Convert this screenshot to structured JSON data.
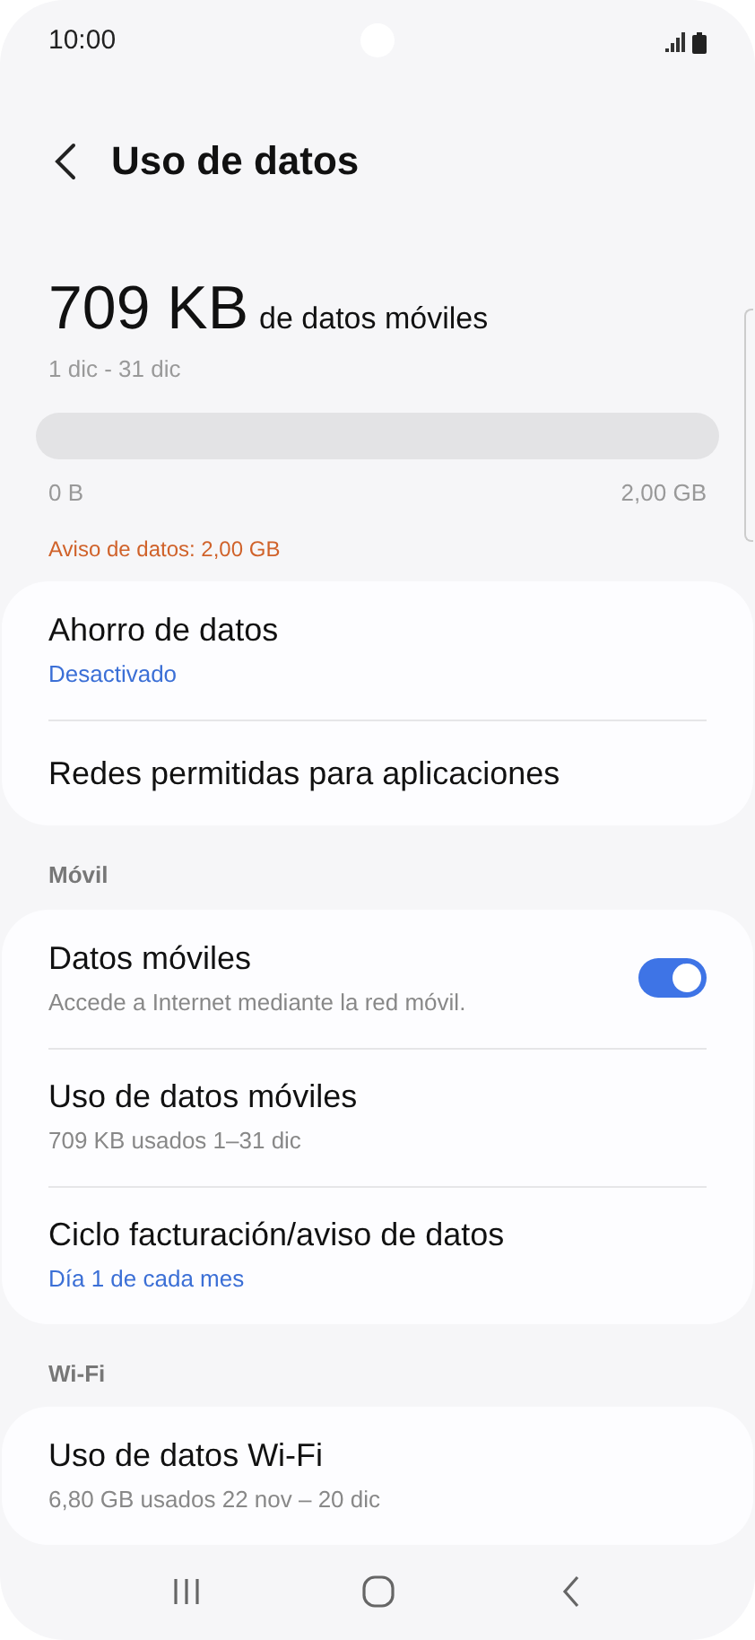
{
  "status_bar": {
    "time": "10:00"
  },
  "header": {
    "title": "Uso de datos"
  },
  "usage": {
    "amount": "709 KB",
    "unit_text": "de datos móviles",
    "period": "1 dic - 31 dic",
    "min_label": "0 B",
    "max_label": "2,00 GB",
    "warning": "Aviso de datos: 2,00 GB"
  },
  "sections": [
    {
      "items": [
        {
          "title": "Ahorro de datos",
          "subtitle": "Desactivado",
          "kind": "value"
        },
        {
          "title": "Redes permitidas para aplicaciones"
        }
      ]
    },
    {
      "heading": "Móvil",
      "items": [
        {
          "title": "Datos móviles",
          "subtitle": "Accede a Internet mediante la red móvil.",
          "kind": "description",
          "switch": {
            "on": true
          }
        },
        {
          "title": "Uso de datos móviles",
          "subtitle": "709 KB usados 1–31 dic",
          "kind": "description"
        },
        {
          "title": "Ciclo facturación/aviso de datos",
          "subtitle": "Día 1 de cada mes",
          "kind": "value"
        }
      ]
    },
    {
      "heading": "Wi-Fi",
      "items": [
        {
          "title": "Uso de datos Wi-Fi",
          "subtitle": "6,80 GB usados 22 nov – 20 dic",
          "kind": "description"
        }
      ]
    }
  ]
}
